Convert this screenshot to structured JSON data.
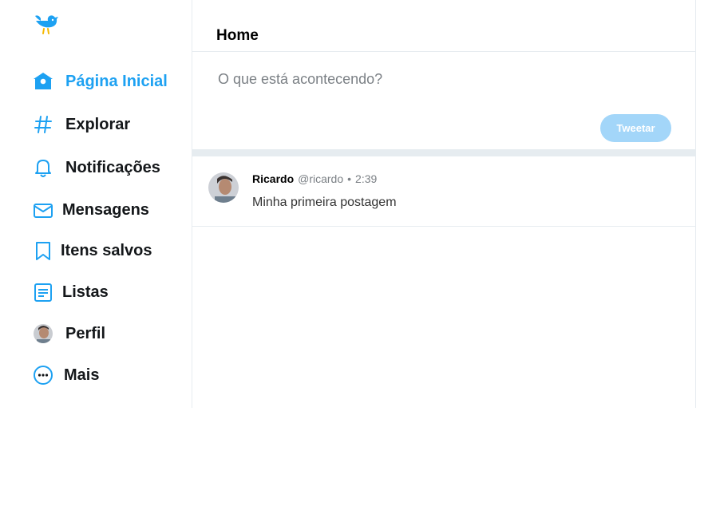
{
  "header": {
    "title": "Home"
  },
  "sidebar": {
    "items": [
      {
        "label": "Página Inicial",
        "icon": "home-icon"
      },
      {
        "label": "Explorar",
        "icon": "hashtag-icon"
      },
      {
        "label": "Notificações",
        "icon": "bell-icon"
      },
      {
        "label": "Mensagens",
        "icon": "envelope-icon"
      },
      {
        "label": "Itens salvos",
        "icon": "bookmark-icon"
      },
      {
        "label": "Listas",
        "icon": "list-icon"
      },
      {
        "label": "Perfil",
        "icon": "avatar"
      },
      {
        "label": "Mais",
        "icon": "more-icon"
      }
    ]
  },
  "composer": {
    "placeholder": "O que está acontecendo?",
    "button_label": "Tweetar"
  },
  "tweets": [
    {
      "name": "Ricardo",
      "handle": "@ricardo",
      "separator": "•",
      "time": "2:39",
      "text": "Minha primeira postagem"
    }
  ],
  "colors": {
    "accent": "#1da1f2",
    "button_disabled": "#a3d6f9",
    "border": "#e6ecf0"
  }
}
